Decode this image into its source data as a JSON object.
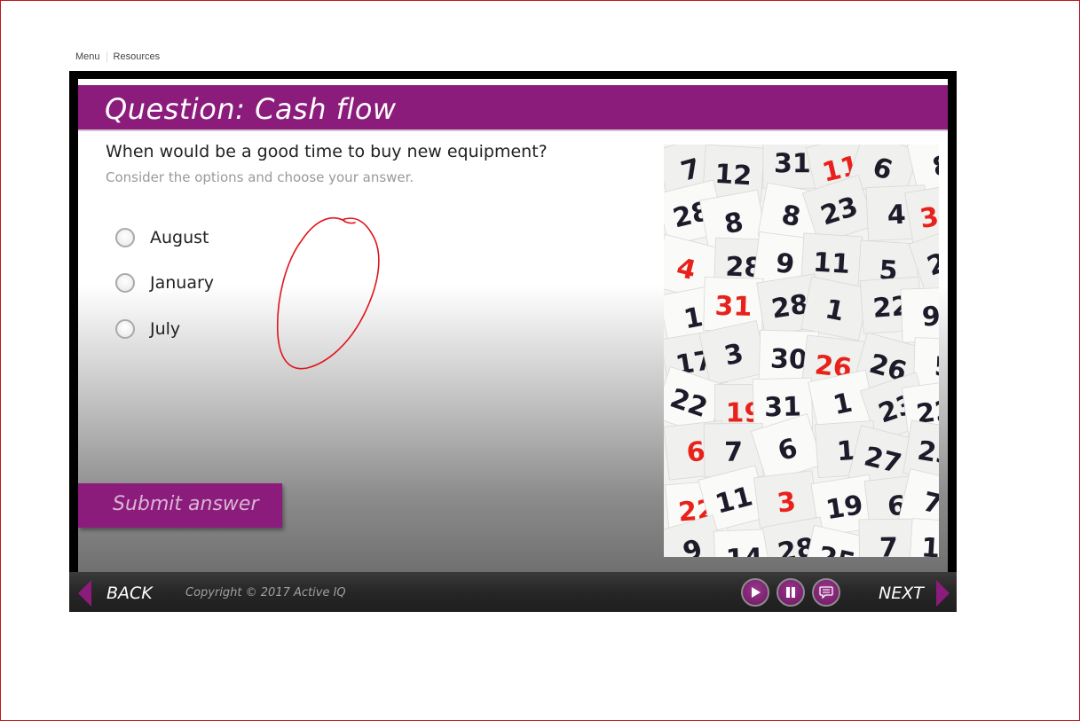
{
  "top_nav": {
    "menu": "Menu",
    "resources": "Resources"
  },
  "slide": {
    "title": "Question: Cash flow",
    "question": "When would be a good time to buy new equipment?",
    "instruction": "Consider the options and choose your answer.",
    "options": [
      {
        "label": "August",
        "selected": false
      },
      {
        "label": "January",
        "selected": false
      },
      {
        "label": "July",
        "selected": false
      }
    ],
    "submit_label": "Submit answer",
    "image_description_icon": "calendar-pages-photo"
  },
  "controls": {
    "back_label": "BACK",
    "next_label": "NEXT",
    "copyright": "Copyright © 2017 Active IQ",
    "buttons": [
      "play-icon",
      "pause-icon",
      "transcript-icon"
    ]
  },
  "colors": {
    "accent": "#8b1c7c",
    "annotation": "#e0151c",
    "frame": "#c0161e"
  }
}
